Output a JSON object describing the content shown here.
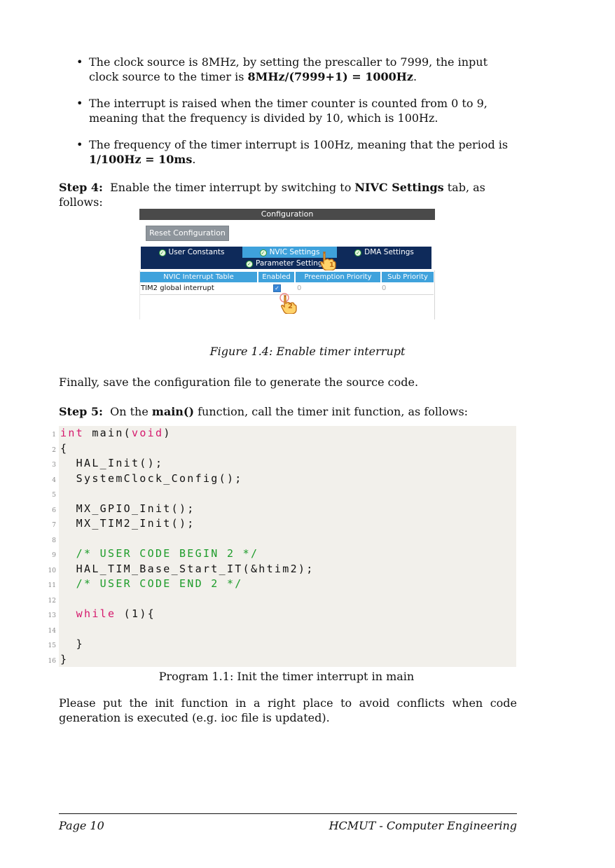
{
  "bullets": [
    {
      "pre": "The clock source is 8MHz, by setting the prescaller to 7999, the input clock source to the timer is ",
      "bold": "8MHz/(7999+1) = 1000Hz",
      "post": "."
    },
    {
      "pre": "The interrupt is raised when the timer counter is counted from 0 to 9, meaning that the frequency is divided by 10, which is 100Hz.",
      "bold": "",
      "post": ""
    },
    {
      "pre": "The frequency of the timer interrupt is 100Hz, meaning that the period is ",
      "bold": "1/100Hz = 10ms",
      "post": "."
    }
  ],
  "step4": {
    "label": "Step 4:",
    "pre": "Enable the timer interrupt by switching to ",
    "bold": "NIVC Settings",
    "post": " tab, as follows:"
  },
  "figure": {
    "title": "Configuration",
    "reset_button": "Reset Configuration",
    "tabs": {
      "user_constants": "User Constants",
      "nvic_settings": "NVIC Settings",
      "dma_settings": "DMA Settings",
      "parameter_settings": "Parameter Settings"
    },
    "table_headers": [
      "NVIC Interrupt Table",
      "Enabled",
      "Preemption Priority",
      "Sub Priority"
    ],
    "row": {
      "name": "TIM2 global interrupt",
      "enabled": true,
      "preemption": "0",
      "sub": "0"
    },
    "markers": [
      "1",
      "2"
    ],
    "colors": {
      "tab_dark": "#0e2a5a",
      "tab_active": "#3fa2dc",
      "title_bar": "#4a4a4a"
    }
  },
  "fig_caption": {
    "label": "Figure 1.4",
    "text": ": Enable timer interrupt"
  },
  "finally": "Finally, save the configuration file to generate the source code.",
  "step5": {
    "label": "Step 5:",
    "pre": "On the ",
    "bold": "main()",
    "post": " function, call the timer init function, as follows:"
  },
  "code_lines": [
    {
      "n": "1",
      "segs": [
        {
          "t": "int",
          "c": "kw"
        },
        {
          "t": " main(",
          "c": ""
        },
        {
          "t": "void",
          "c": "kw"
        },
        {
          "t": ")",
          "c": ""
        }
      ]
    },
    {
      "n": "2",
      "segs": [
        {
          "t": "{",
          "c": ""
        }
      ]
    },
    {
      "n": "3",
      "segs": [
        {
          "t": "  HAL_Init();",
          "c": ""
        }
      ]
    },
    {
      "n": "4",
      "segs": [
        {
          "t": "  SystemClock_Config();",
          "c": ""
        }
      ]
    },
    {
      "n": "5",
      "segs": []
    },
    {
      "n": "6",
      "segs": [
        {
          "t": "  MX_GPIO_Init();",
          "c": ""
        }
      ]
    },
    {
      "n": "7",
      "segs": [
        {
          "t": "  MX_TIM2_Init();",
          "c": ""
        }
      ]
    },
    {
      "n": "8",
      "segs": []
    },
    {
      "n": "9",
      "segs": [
        {
          "t": "  /* USER CODE BEGIN 2 */",
          "c": "cm"
        }
      ]
    },
    {
      "n": "10",
      "segs": [
        {
          "t": "  HAL_TIM_Base_Start_IT(&htim2);",
          "c": ""
        }
      ]
    },
    {
      "n": "11",
      "segs": [
        {
          "t": "  /* USER CODE END 2 */",
          "c": "cm"
        }
      ]
    },
    {
      "n": "12",
      "segs": []
    },
    {
      "n": "13",
      "segs": [
        {
          "t": "  ",
          "c": ""
        },
        {
          "t": "while",
          "c": "kw"
        },
        {
          "t": " (1){",
          "c": ""
        }
      ]
    },
    {
      "n": "14",
      "segs": []
    },
    {
      "n": "15",
      "segs": [
        {
          "t": "  }",
          "c": ""
        }
      ]
    },
    {
      "n": "16",
      "segs": [
        {
          "t": "}",
          "c": ""
        }
      ]
    }
  ],
  "prog_caption": "Program 1.1: Init the timer interrupt in main",
  "closing": "Please put the init function in a right place to avoid conflicts when code generation is executed (e.g. ioc file is updated).",
  "footer": {
    "left": "Page 10",
    "right": "HCMUT - Computer Engineering"
  }
}
